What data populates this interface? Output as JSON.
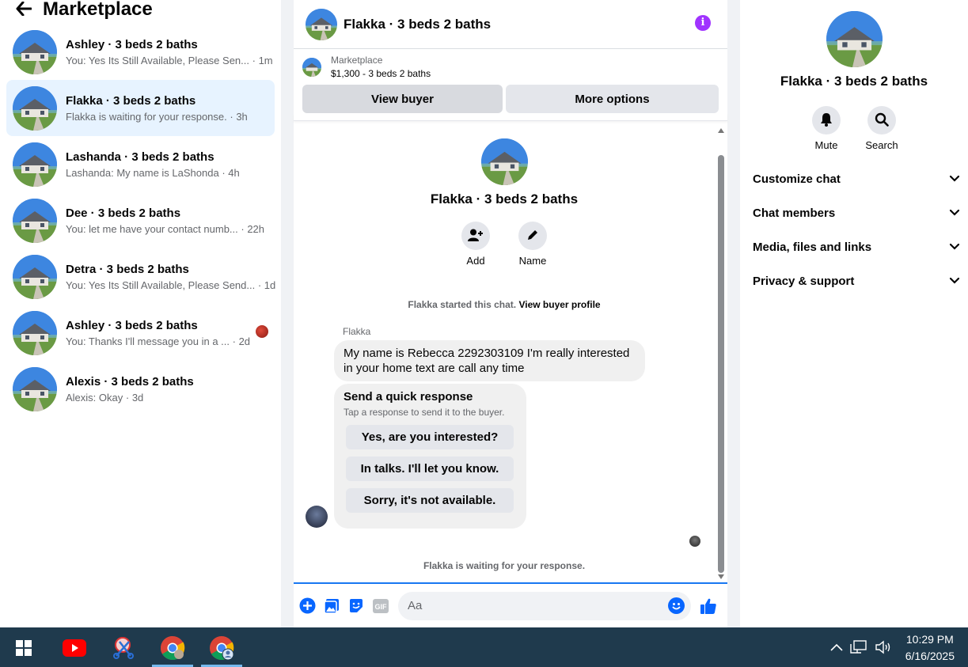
{
  "left": {
    "back_icon": "arrow-left-icon",
    "title": "Marketplace",
    "conversations": [
      {
        "name": "Ashley · 3 beds 2 baths",
        "preview": "You: Yes Its Still Available, Please Sen...",
        "time": "· 1m",
        "active": false
      },
      {
        "name": "Flakka · 3 beds 2 baths",
        "preview": "Flakka is waiting for your response.",
        "time": "· 3h",
        "active": true
      },
      {
        "name": "Lashanda · 3 beds 2 baths",
        "preview": "Lashanda: My name is LaShonda",
        "time": "· 4h",
        "active": false
      },
      {
        "name": "Dee · 3 beds 2 baths",
        "preview": "You: let me have your contact numb...",
        "time": "· 22h",
        "active": false
      },
      {
        "name": "Detra · 3 beds 2 baths",
        "preview": "You: Yes Its Still Available, Please Send...",
        "time": "· 1d",
        "active": false
      },
      {
        "name": "Ashley · 3 beds 2 baths",
        "preview": "You: Thanks I'll message you in a ...",
        "time": "· 2d",
        "active": false
      },
      {
        "name": "Alexis · 3 beds 2 baths",
        "preview": "Alexis: Okay",
        "time": "· 3d",
        "active": false
      }
    ]
  },
  "middle": {
    "title": "Flakka · 3 beds 2 baths",
    "info_icon": "info-icon",
    "marketplace_label": "Marketplace",
    "listing": "$1,300 - 3 beds 2 baths",
    "view_buyer": "View buyer",
    "more_options": "More options",
    "profile_name": "Flakka · 3 beds 2 baths",
    "add_label": "Add",
    "name_label": "Name",
    "started_text": "Flakka started this chat.",
    "view_buyer_profile": "View buyer profile",
    "sender": "Flakka",
    "message": "My name is Rebecca 2292303109 I'm really interested in your home text are call any time",
    "quick_title": "Send a quick response",
    "quick_sub": "Tap a response to send it to the buyer.",
    "quick_options": [
      "Yes, are you interested?",
      "In talks. I'll let you know.",
      "Sorry, it's not available."
    ],
    "waiting": "Flakka is waiting for your response.",
    "composer_placeholder": "Aa"
  },
  "right": {
    "name": "Flakka · 3 beds 2 baths",
    "mute_label": "Mute",
    "search_label": "Search",
    "sections": [
      "Customize chat",
      "Chat members",
      "Media, files and links",
      "Privacy & support"
    ]
  },
  "taskbar": {
    "time": "10:29 PM",
    "date": "6/16/2025"
  },
  "colors": {
    "accent": "#0866ff",
    "active_row": "#e7f3ff",
    "info": "#a033ff",
    "taskbar": "#1f3a4d"
  }
}
